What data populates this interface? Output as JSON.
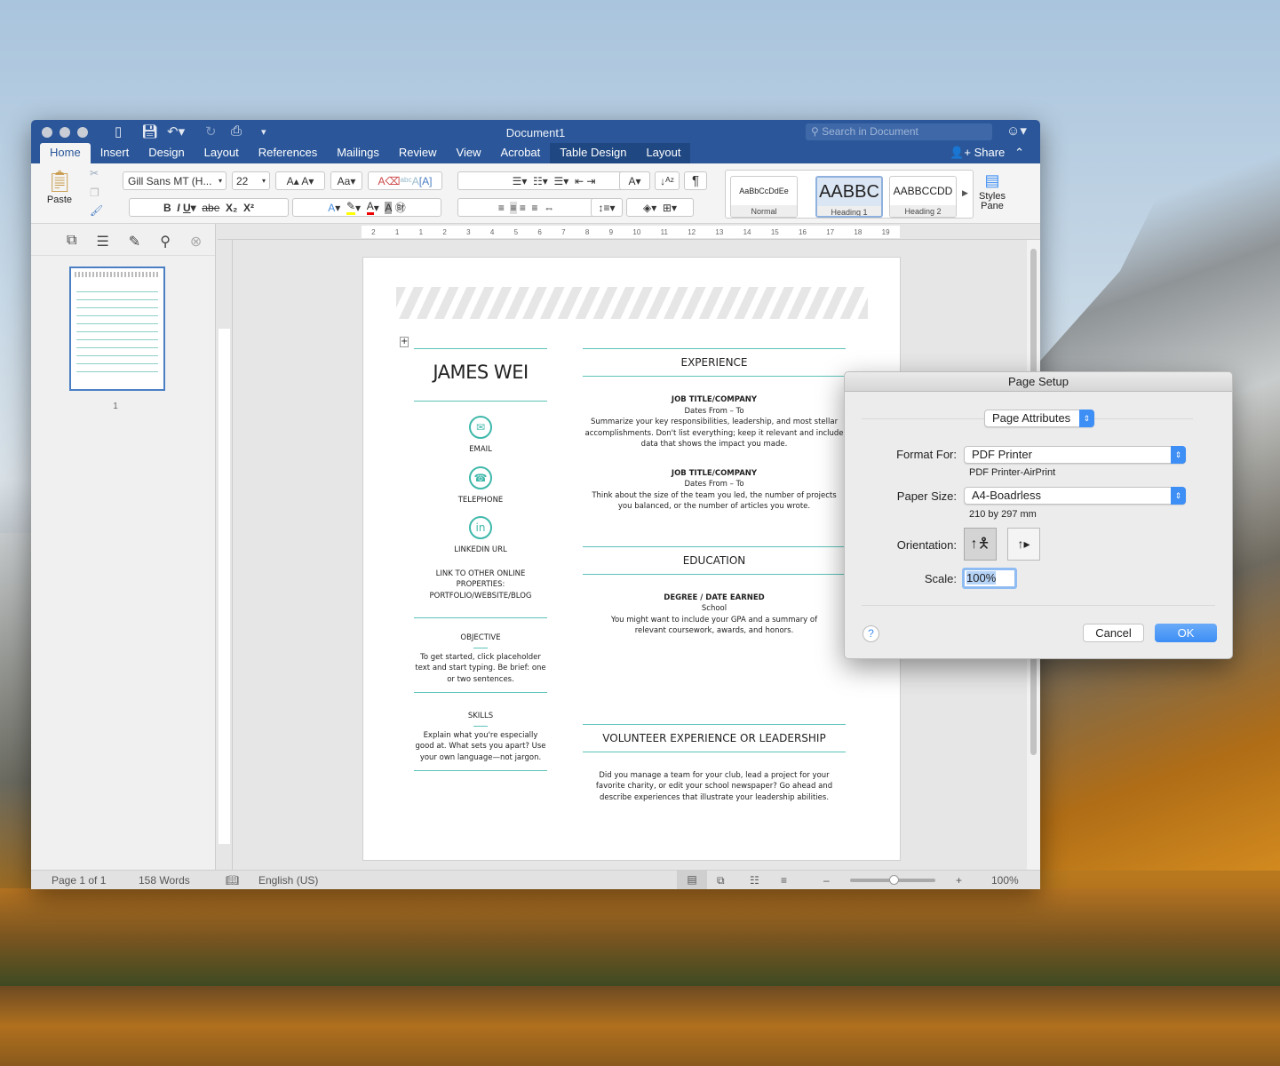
{
  "window": {
    "title": "Document1",
    "search_placeholder": "Search in Document",
    "share": "Share"
  },
  "tabs": [
    "Home",
    "Insert",
    "Design",
    "Layout",
    "References",
    "Mailings",
    "Review",
    "View",
    "Acrobat",
    "Table Design",
    "Layout"
  ],
  "ribbon": {
    "paste": "Paste",
    "font": "Gill Sans MT (H...",
    "size": "22",
    "styles": [
      {
        "sample": "AaBbCcDdEe",
        "name": "Normal"
      },
      {
        "sample": "AABBC",
        "name": "Heading 1"
      },
      {
        "sample": "AABBCCDD",
        "name": "Heading 2"
      }
    ],
    "styles_pane": "Styles Pane"
  },
  "nav": {
    "page_number": "1"
  },
  "ruler": [
    "2",
    "1",
    "1",
    "2",
    "3",
    "4",
    "5",
    "6",
    "7",
    "8",
    "9",
    "10",
    "11",
    "12",
    "13",
    "14",
    "15",
    "16",
    "17",
    "18",
    "19"
  ],
  "resume": {
    "name": "JAMES WEI",
    "contacts": [
      {
        "icon": "email-icon",
        "label": "EMAIL"
      },
      {
        "icon": "telephone-icon",
        "label": "TELEPHONE"
      },
      {
        "icon": "linkedin-icon",
        "label": "LINKEDIN URL"
      }
    ],
    "other_links": "LINK TO OTHER ONLINE PROPERTIES: PORTFOLIO/WEBSITE/BLOG",
    "objective": {
      "title": "OBJECTIVE",
      "text": "To get started, click placeholder text and start typing. Be brief: one or two sentences."
    },
    "skills": {
      "title": "SKILLS",
      "text": "Explain what you're especially good at. What sets you apart? Use your own language—not jargon."
    },
    "experience": {
      "title": "EXPERIENCE",
      "jobs": [
        {
          "title": "JOB TITLE/COMPANY",
          "dates": "Dates From – To",
          "text": "Summarize your key responsibilities, leadership, and most stellar accomplishments. Don't list everything; keep it relevant and include data that shows the impact you made."
        },
        {
          "title": "JOB TITLE/COMPANY",
          "dates": "Dates From – To",
          "text": "Think about the size of the team you led, the number of projects you balanced, or the number of articles you wrote."
        }
      ]
    },
    "education": {
      "title": "EDUCATION",
      "degree": "DEGREE / DATE EARNED",
      "school": "School",
      "text": "You might want to include your GPA and a summary of relevant coursework, awards, and honors."
    },
    "volunteer": {
      "title": "VOLUNTEER EXPERIENCE OR LEADERSHIP",
      "text": "Did you manage a team for your club, lead a project for your favorite charity, or edit your school newspaper? Go ahead and describe experiences that illustrate your leadership abilities."
    }
  },
  "status": {
    "page": "Page 1 of 1",
    "words": "158 Words",
    "language": "English (US)",
    "zoom": "100%",
    "zoom_level": 100
  },
  "dialog": {
    "title": "Page Setup",
    "panel": "Page Attributes",
    "format_label": "Format For:",
    "format_value": "PDF Printer",
    "format_sub": "PDF Printer-AirPrint",
    "paper_label": "Paper Size:",
    "paper_value": "A4-Boadrless",
    "paper_sub": "210 by 297 mm",
    "orientation_label": "Orientation:",
    "orientation_selected": "portrait",
    "scale_label": "Scale:",
    "scale_value": "100%",
    "help": "?",
    "cancel": "Cancel",
    "ok": "OK"
  },
  "colors": {
    "accent": "#2b579a",
    "teal": "#3fb8ab",
    "ok_button": "#3d8ef5"
  }
}
